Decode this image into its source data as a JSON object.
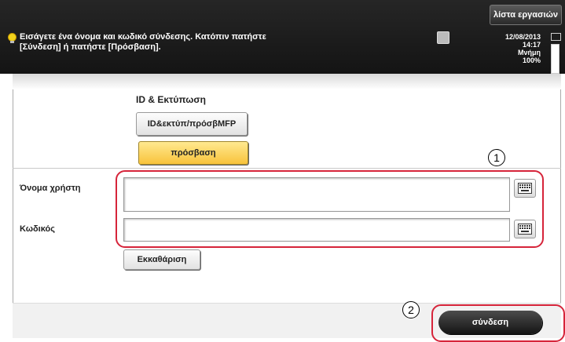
{
  "header": {
    "job_list_label": "λίστα εργασιών",
    "message_line1": "Εισάγετε ένα όνομα και κωδικό σύνδεσης. Κατόπιν πατήστε",
    "message_line2": "[Σύνδεση] ή πατήστε [Πρόσβαση].",
    "date": "12/08/2013",
    "time": "14:17",
    "memory_label": "Μνήμη",
    "memory_value": "100%"
  },
  "auth": {
    "title": "ID & Εκτύπωση",
    "id_print_button": "ID&εκτύπ/πρόσβMFP",
    "access_button": "πρόσβαση"
  },
  "form": {
    "username_label": "Όνομα χρήστη",
    "username_value": "",
    "password_label": "Κωδικός",
    "password_value": "",
    "clear_button": "Εκκαθάριση"
  },
  "callouts": {
    "one": "1",
    "two": "2"
  },
  "footer": {
    "login_button": "σύνδεση"
  },
  "icons": [
    "info-bulb-icon",
    "print-job-icon",
    "envelope-icon",
    "keyboard-icon"
  ],
  "colors": {
    "callout_red": "#d6243a",
    "accent_yellow": "#f8c33b",
    "header_bg": "#1e1e1e"
  }
}
